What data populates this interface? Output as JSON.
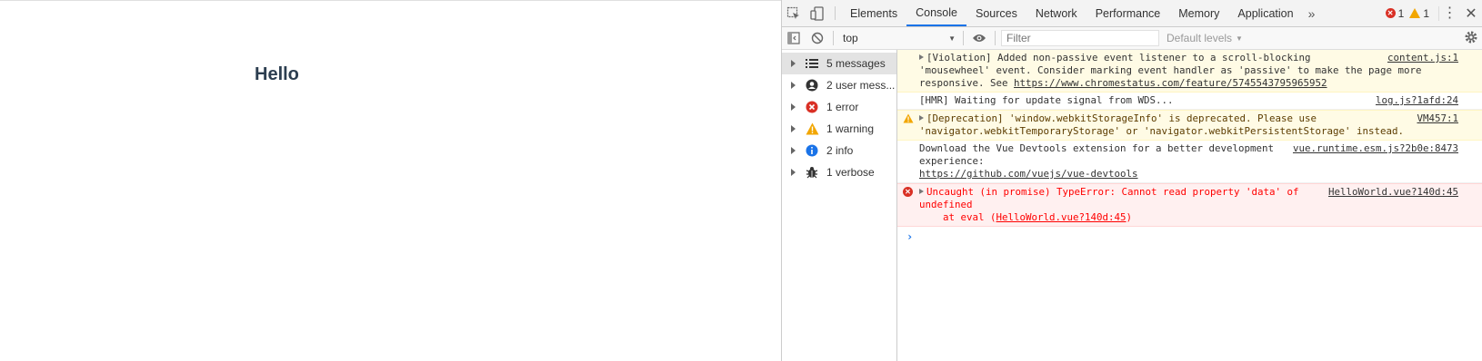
{
  "page": {
    "title": "Hello"
  },
  "devtools": {
    "tabs": [
      {
        "label": "Elements"
      },
      {
        "label": "Console"
      },
      {
        "label": "Sources"
      },
      {
        "label": "Network"
      },
      {
        "label": "Performance"
      },
      {
        "label": "Memory"
      },
      {
        "label": "Application"
      }
    ],
    "more_tabs": "»",
    "error_count": "1",
    "warning_count": "1",
    "kebab": "⋮",
    "close": "✕"
  },
  "toolbar": {
    "context": "top",
    "filter_placeholder": "Filter",
    "levels": "Default levels"
  },
  "sidebar": {
    "items": [
      {
        "label": "5 messages",
        "icon": "list-icon"
      },
      {
        "label": "2 user mess...",
        "icon": "user-icon"
      },
      {
        "label": "1 error",
        "icon": "error-icon"
      },
      {
        "label": "1 warning",
        "icon": "warning-icon"
      },
      {
        "label": "2 info",
        "icon": "info-icon"
      },
      {
        "label": "1 verbose",
        "icon": "bug-icon"
      }
    ]
  },
  "console": {
    "messages": [
      {
        "type": "violation",
        "line1": "[Violation] Added non-passive event listener to a scroll-blocking",
        "line2": "'mousewheel' event. Consider marking event handler as 'passive' to make the page more",
        "line3_pre": "responsive. See ",
        "link": "https://www.chromestatus.com/feature/5745543795965952",
        "source": "content.js:1"
      },
      {
        "type": "log",
        "text": "[HMR] Waiting for update signal from WDS...",
        "source": "log.js?1afd:24"
      },
      {
        "type": "warning",
        "line1": "[Deprecation] 'window.webkitStorageInfo' is deprecated. Please use",
        "line2": "'navigator.webkitTemporaryStorage' or 'navigator.webkitPersistentStorage' instead.",
        "source": "VM457:1"
      },
      {
        "type": "log",
        "line1": "Download the Vue Devtools extension for a better development",
        "line2": "experience:",
        "link": "https://github.com/vuejs/vue-devtools",
        "source": "vue.runtime.esm.js?2b0e:8473"
      },
      {
        "type": "error",
        "line1": "Uncaught (in promise) TypeError: Cannot read property 'data' of",
        "line2": "undefined",
        "line3_pre": "at eval (",
        "link": "HelloWorld.vue?140d:45",
        "line3_post": ")",
        "source": "HelloWorld.vue?140d:45"
      }
    ],
    "prompt": "›"
  },
  "colors": {
    "accent": "#1a73e8",
    "error": "#d93025",
    "warning": "#f2a600",
    "title": "#2c3e50"
  }
}
